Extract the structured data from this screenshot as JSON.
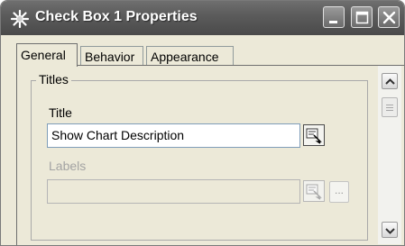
{
  "window": {
    "title": "Check Box 1 Properties",
    "app_icon": "gear-icon",
    "controls": [
      "minimize-icon",
      "maximize-icon",
      "close-icon"
    ]
  },
  "tabs": [
    {
      "label": "General",
      "active": true
    },
    {
      "label": "Behavior",
      "active": false
    },
    {
      "label": "Appearance",
      "active": false
    }
  ],
  "titles_group": {
    "label": "Titles",
    "title_field": {
      "label": "Title",
      "value": "Show Chart Description",
      "button_icon": "field-picker-icon"
    },
    "labels_field": {
      "label": "Labels",
      "value": "",
      "enabled": false,
      "button_icon": "field-picker-icon",
      "ellipsis": "..."
    }
  },
  "scrollbar": {
    "up_icon": "arrow-up-icon",
    "down_icon": "arrow-down-icon"
  },
  "colors": {
    "titlebar": "#5c5c5c",
    "dialog_bg": "#ece9d8",
    "disabled_text": "#a3a3a3"
  }
}
